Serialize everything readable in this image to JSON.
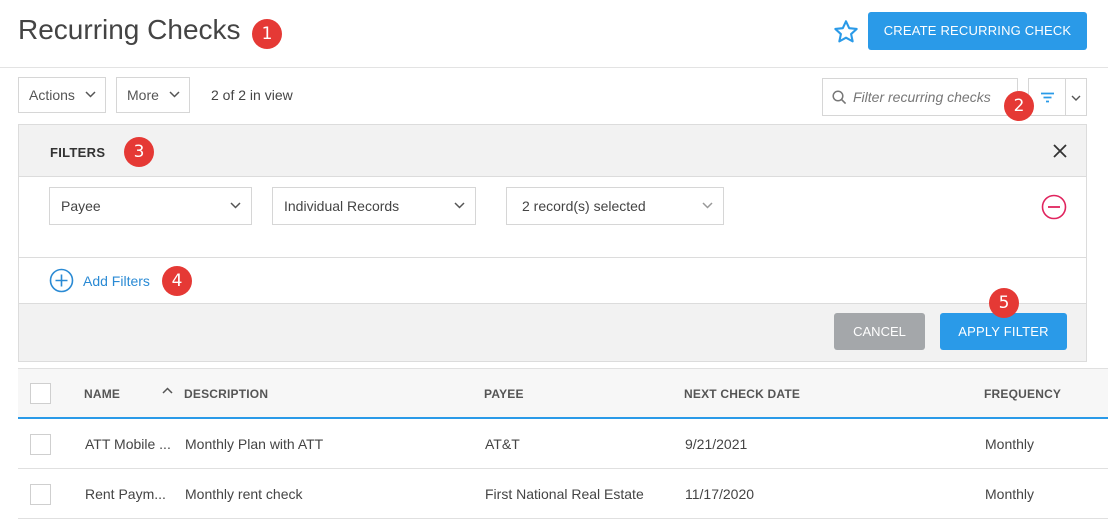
{
  "header": {
    "title": "Recurring Checks",
    "create_button": "CREATE RECURRING CHECK",
    "favorite_icon": "star-outline-icon"
  },
  "annotations": [
    "1",
    "2",
    "3",
    "4",
    "5"
  ],
  "toolbar": {
    "actions_label": "Actions",
    "more_label": "More",
    "view_count": "2 of 2 in view",
    "search_placeholder": "Filter recurring checks"
  },
  "filters": {
    "title": "FILTERS",
    "rows": [
      {
        "field": "Payee",
        "mode": "Individual Records",
        "selection": "2 record(s) selected"
      }
    ],
    "add_label": "Add Filters",
    "cancel_label": "CANCEL",
    "apply_label": "APPLY FILTER"
  },
  "table": {
    "columns": [
      "NAME",
      "DESCRIPTION",
      "PAYEE",
      "NEXT CHECK DATE",
      "FREQUENCY"
    ],
    "rows": [
      {
        "name": "ATT Mobile ...",
        "description": "Monthly Plan with ATT",
        "payee": "AT&T",
        "next_check_date": "9/21/2021",
        "frequency": "Monthly"
      },
      {
        "name": "Rent Paym...",
        "description": "Monthly rent check",
        "payee": "First National Real Estate",
        "next_check_date": "11/17/2020",
        "frequency": "Monthly"
      }
    ]
  },
  "colors": {
    "accent": "#2a9ae8",
    "badge": "#e53935",
    "remove": "#e0245e",
    "cancel": "#a4a7aa"
  }
}
